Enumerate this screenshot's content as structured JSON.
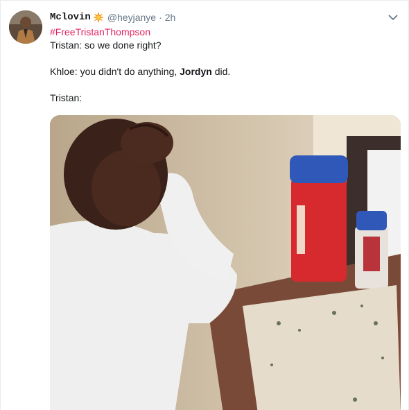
{
  "tweet": {
    "display_name": "Mclovin",
    "name_emoji": "collision-emoji",
    "handle": "@heyjanye",
    "separator": "·",
    "time": "2h",
    "hashtag": "#FreeTristanThompson",
    "line1": "Tristan: so we done right?",
    "line2_prefix": "Khloe: you didn't do anything, ",
    "line2_bold": "Jordyn",
    "line2_suffix": " did.",
    "line3": "Tristan:"
  },
  "colors": {
    "hashtag": "#e0245e",
    "muted": "#657786",
    "text": "#14171a",
    "border": "#e6ecf0"
  },
  "icons": {
    "menu": "chevron-down-icon"
  }
}
